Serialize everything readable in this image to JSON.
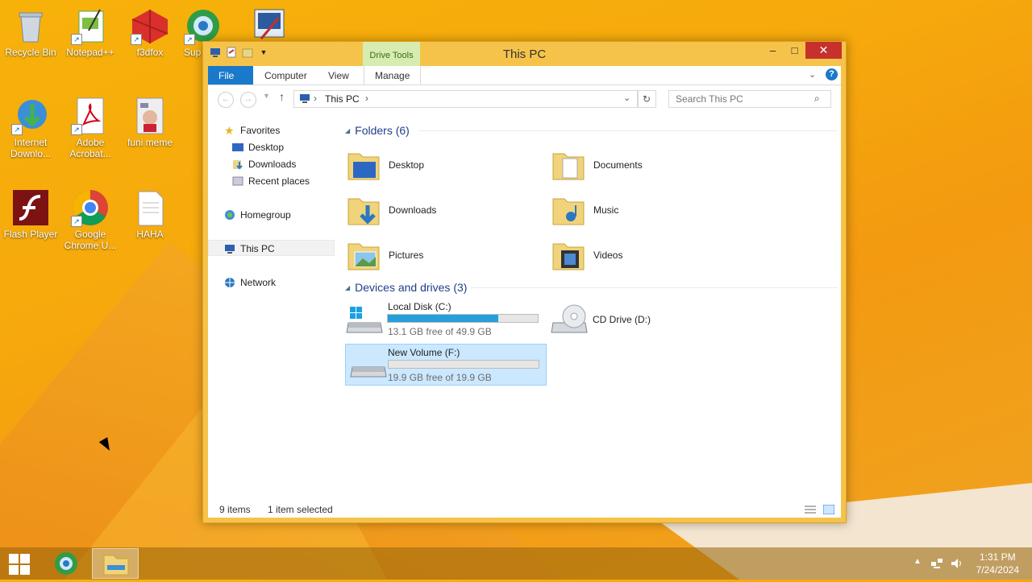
{
  "desktop": {
    "icons": [
      {
        "label": "Recycle Bin"
      },
      {
        "label": "Notepad++"
      },
      {
        "label": "f3dfox"
      },
      {
        "label": "Sup"
      },
      {
        "label": "Internet Downlo..."
      },
      {
        "label": "Adobe Acrobat..."
      },
      {
        "label": "funi meme"
      },
      {
        "label": "Flash Player"
      },
      {
        "label": "Google Chrome U..."
      },
      {
        "label": "HAHA"
      }
    ]
  },
  "window": {
    "title": "This PC",
    "context_tab": "Drive Tools",
    "controls": {
      "minimize": "–",
      "maximize": "□",
      "close": "✕"
    },
    "ribbon_tabs": [
      "File",
      "Computer",
      "View",
      "Manage"
    ],
    "address": {
      "location": "This PC",
      "separator": "›"
    },
    "search_placeholder": "Search This PC",
    "nav": {
      "favorites": "Favorites",
      "desktop": "Desktop",
      "downloads": "Downloads",
      "recent": "Recent places",
      "homegroup": "Homegroup",
      "thispc": "This PC",
      "network": "Network"
    },
    "folders_header": "Folders (6)",
    "folders": [
      "Desktop",
      "Documents",
      "Downloads",
      "Music",
      "Pictures",
      "Videos"
    ],
    "devices_header": "Devices and drives (3)",
    "drives": [
      {
        "name": "Local Disk (C:)",
        "free": "13.1 GB free of 49.9 GB",
        "used_fraction": 0.737
      },
      {
        "name": "CD Drive (D:)"
      },
      {
        "name": "New Volume (F:)",
        "free": "19.9 GB free of 19.9 GB",
        "used_fraction": 0.0
      }
    ],
    "status": {
      "count": "9 items",
      "selected": "1 item selected"
    }
  },
  "taskbar": {
    "time": "1:31 PM",
    "date": "7/24/2024"
  },
  "colors": {
    "accent": "#1979ca",
    "bar_fill": "#26a0da",
    "close": "#c7312c",
    "selection": "#cce8ff"
  }
}
